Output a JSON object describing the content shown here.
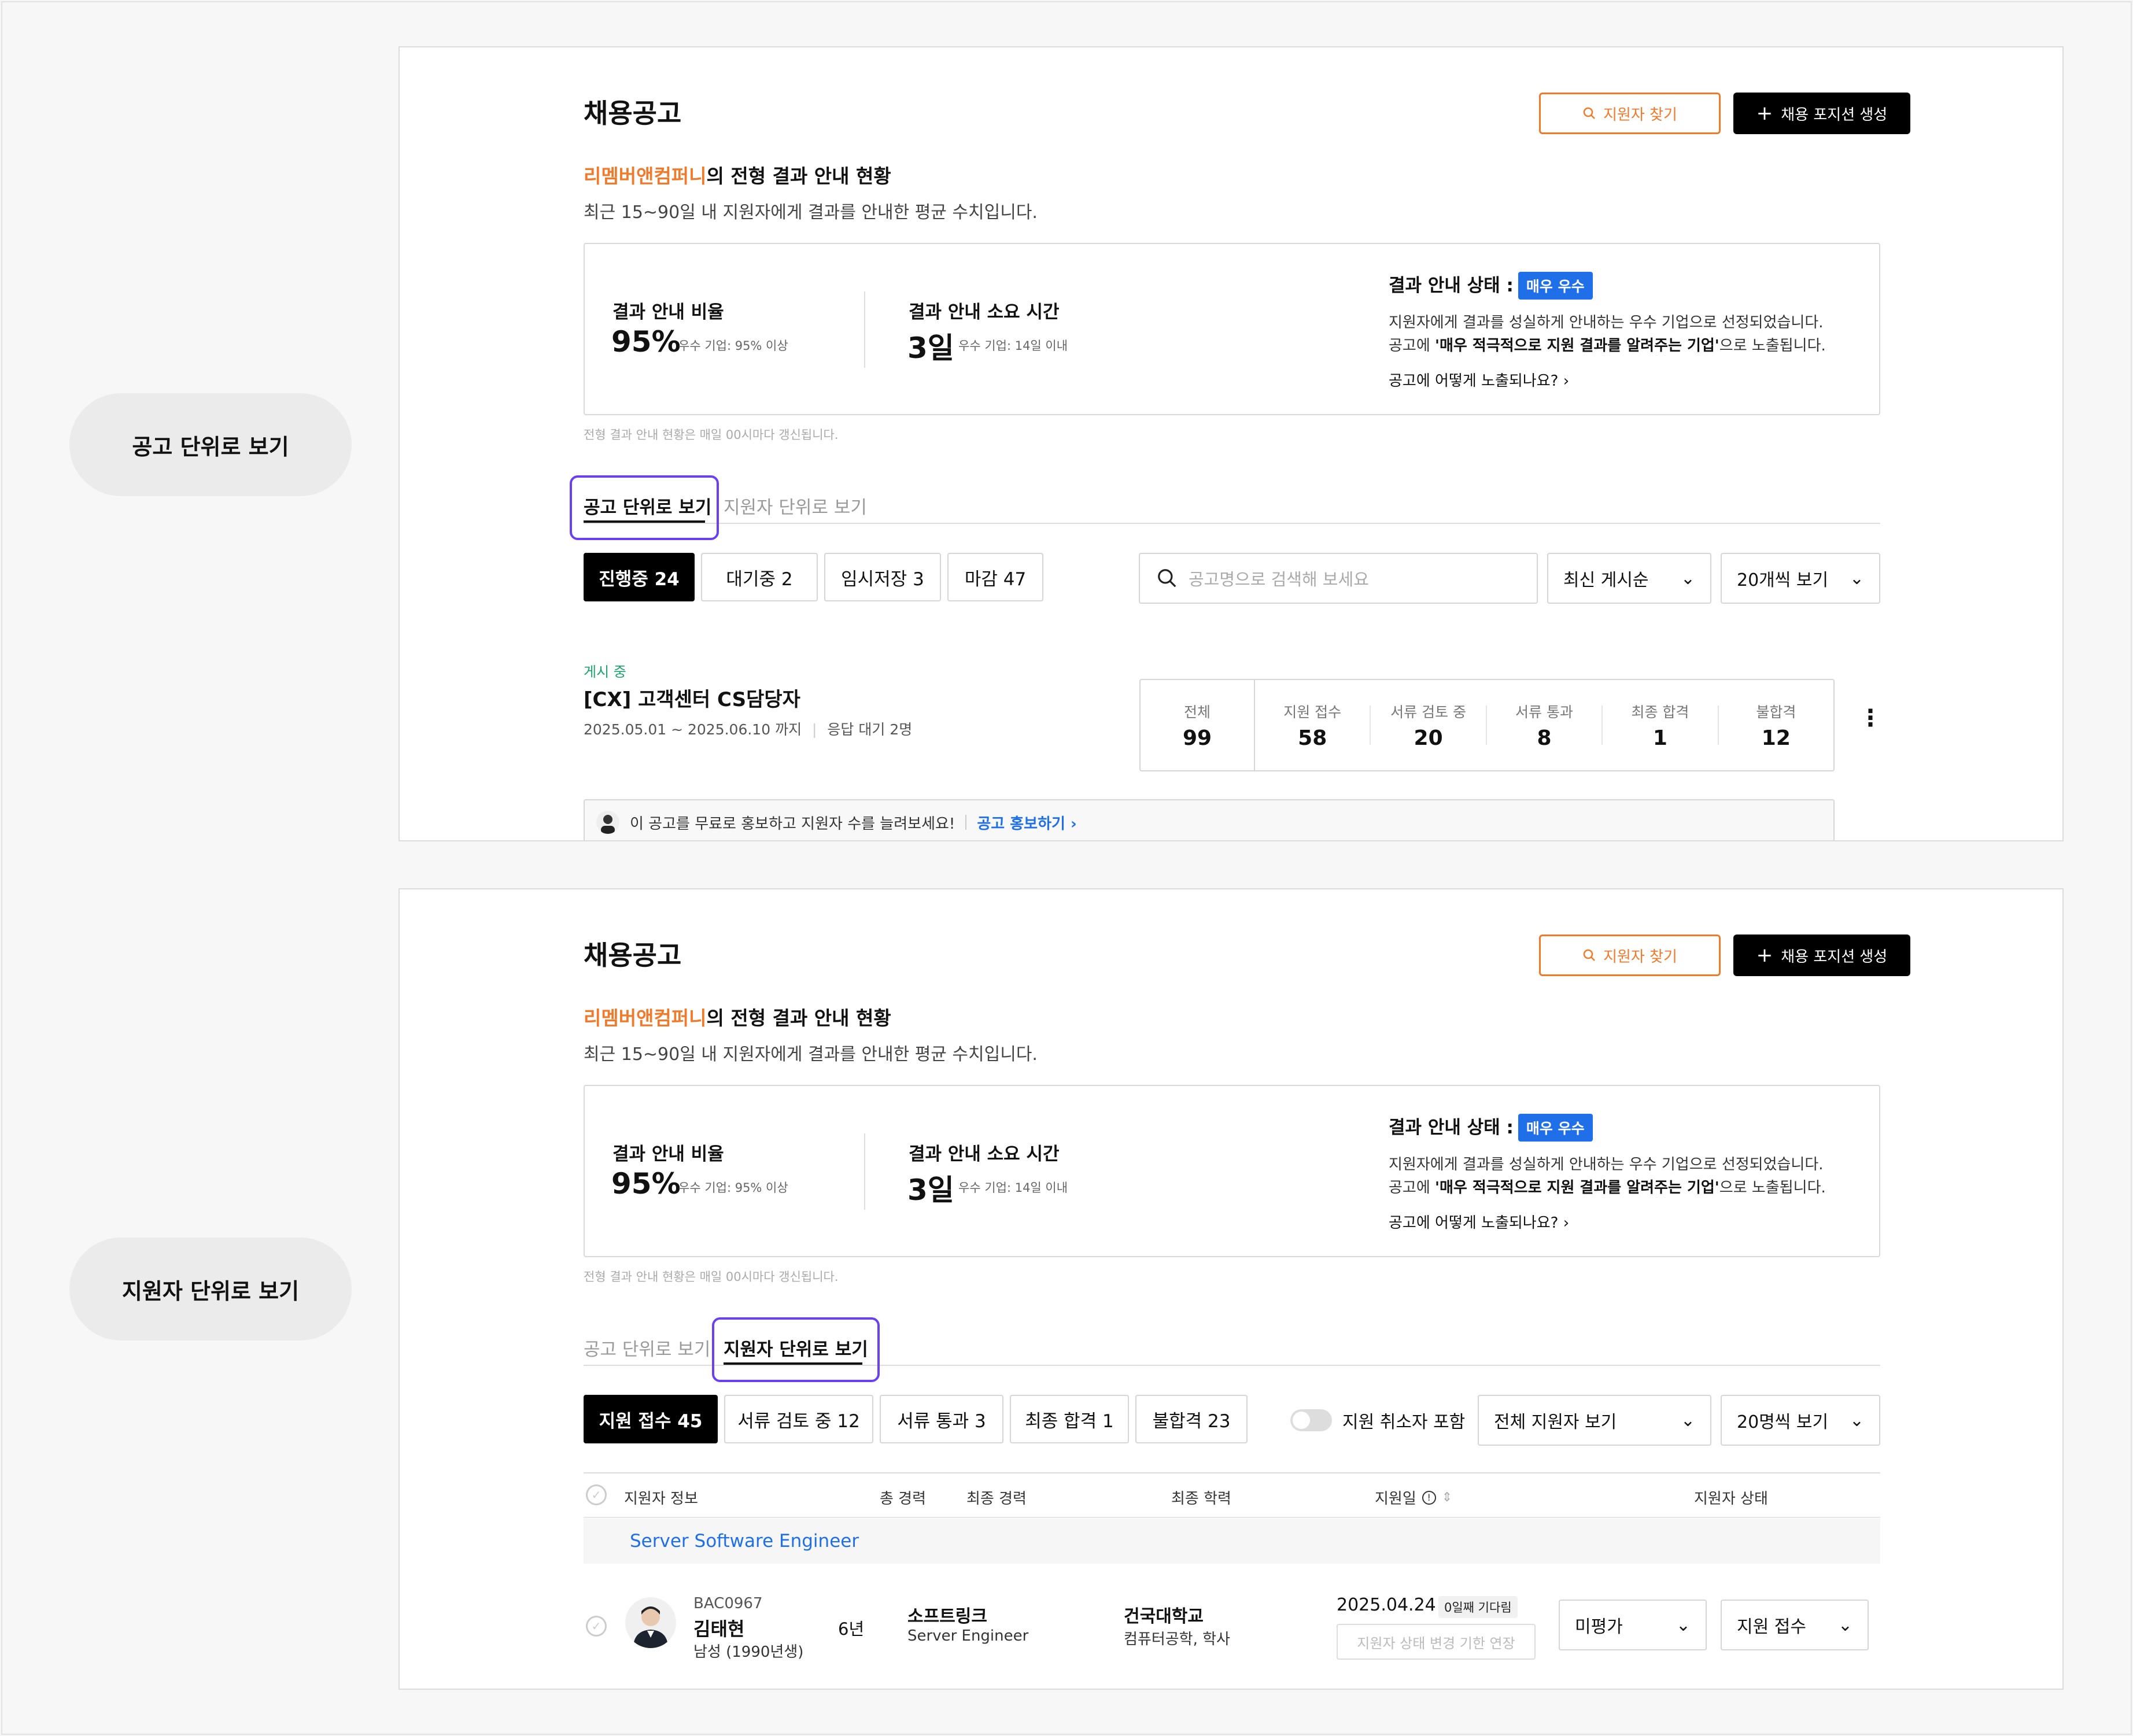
{
  "side_labels": {
    "job_view": "공고 단위로 보기",
    "applicant_view": "지원자 단위로 보기"
  },
  "header": {
    "title": "채용공고",
    "find_btn": "지원자 찾기",
    "create_btn": "채용 포지션 생성"
  },
  "company": {
    "name": "리멤버앤컴퍼니",
    "suffix": "의 전형 결과 안내 현황",
    "desc": "최근 15~90일 내 지원자에게 결과를 안내한 평균 수치입니다."
  },
  "stats": {
    "ratio_label": "결과 안내 비율",
    "ratio_value": "95%",
    "ratio_note": "우수 기업: 95% 이상",
    "time_label": "결과 안내 소요 시간",
    "time_value": "3일",
    "time_note": "우수 기업: 14일 이내",
    "status_label": "결과 안내 상태 :",
    "status_badge": "매우 우수",
    "status_line1": "지원자에게 결과를 성실하게 안내하는 우수 기업으로 선정되었습니다.",
    "status_line2_pre": "공고에 ",
    "status_line2_bold": "'매우 적극적으로 지원 결과를 알려주는 기업'",
    "status_line2_post": "으로 노출됩니다.",
    "status_link": "공고에 어떻게 노출되나요?",
    "update_note": "전형 결과 안내 현황은 매일 00시마다 갱신됩니다."
  },
  "tabs": {
    "job": "공고 단위로 보기",
    "applicant": "지원자 단위로 보기"
  },
  "job_panel": {
    "chips": [
      "진행중 24",
      "대기중 2",
      "임시저장 3",
      "마감 47"
    ],
    "search_placeholder": "공고명으로 검색해 보세요",
    "sort": "최신 게시순",
    "page_size": "20개씩 보기",
    "post": {
      "status": "게시 중",
      "title": "[CX] 고객센터 CS담당자",
      "period": "2025.05.01 ~ 2025.06.10 까지",
      "pending": "응답 대기 2명",
      "counts": [
        {
          "label": "전체",
          "value": "99"
        },
        {
          "label": "지원 접수",
          "value": "58"
        },
        {
          "label": "서류 검토 중",
          "value": "20"
        },
        {
          "label": "서류 통과",
          "value": "8"
        },
        {
          "label": "최종 합격",
          "value": "1"
        },
        {
          "label": "불합격",
          "value": "12"
        }
      ]
    },
    "promo_text": "이 공고를 무료로 홍보하고 지원자 수를 늘려보세요!",
    "promo_link": "공고 홍보하기"
  },
  "applicant_panel": {
    "chips": [
      "지원 접수 45",
      "서류 검토 중 12",
      "서류 통과 3",
      "최종 합격 1",
      "불합격 23"
    ],
    "toggle_label": "지원 취소자 포함",
    "filter": "전체 지원자 보기",
    "page_size": "20명씩 보기",
    "columns": [
      "지원자 정보",
      "총 경력",
      "최종 경력",
      "최종 학력",
      "지원일",
      "지원자 상태"
    ],
    "group": "Server Software Engineer",
    "row": {
      "id": "BAC0967",
      "name": "김태현",
      "gender": "남성 (1990년생)",
      "career_years": "6년",
      "company": "소프트링크",
      "position": "Server Engineer",
      "school": "건국대학교",
      "major": "컴퓨터공학, 학사",
      "date": "2025.04.24",
      "waiting": "0일째 기다림",
      "extend_placeholder": "지원자 상태 변경 기한 연장",
      "eval": "미평가",
      "status": "지원 접수"
    }
  }
}
